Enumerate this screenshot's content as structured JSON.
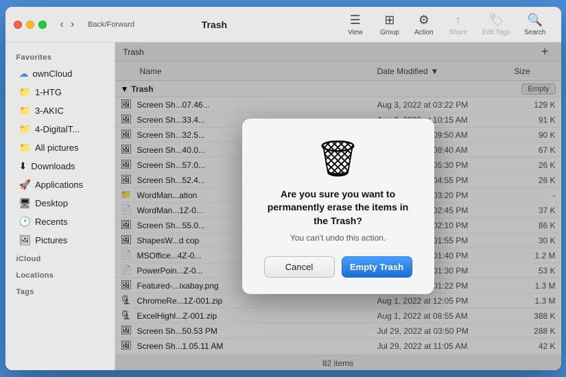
{
  "window": {
    "title": "Trash"
  },
  "traffic_lights": {
    "close": "close",
    "minimize": "minimize",
    "maximize": "maximize"
  },
  "toolbar": {
    "back_forward_label": "Back/Forward",
    "view_label": "View",
    "group_label": "Group",
    "action_label": "Action",
    "share_label": "Share",
    "edit_tags_label": "Edit Tags",
    "search_label": "Search"
  },
  "path_bar": {
    "title": "Trash",
    "add_label": "+"
  },
  "column_headers": {
    "name": "Name",
    "date_modified": "Date Modified",
    "size": "Size"
  },
  "trash_bar": {
    "label": "Trash",
    "empty_btn": "Empty"
  },
  "files": [
    {
      "icon": "🖼",
      "name": "Screen Sh...07.46...",
      "date": "Aug 3, 2022 at 03:22 PM",
      "size": "129 K"
    },
    {
      "icon": "🖼",
      "name": "Screen Sh...33.4...",
      "date": "Aug 2, 2022 at 10:15 AM",
      "size": "91 K"
    },
    {
      "icon": "🖼",
      "name": "Screen Sh...32.5...",
      "date": "Aug 2, 2022 at 09:50 AM",
      "size": "90 K"
    },
    {
      "icon": "🖼",
      "name": "Screen Sh...40.0...",
      "date": "Aug 2, 2022 at 08:40 AM",
      "size": "67 K"
    },
    {
      "icon": "🖼",
      "name": "Screen Sh...57.0...",
      "date": "Aug 1, 2022 at 05:30 PM",
      "size": "26 K"
    },
    {
      "icon": "🖼",
      "name": "Screen Sh...52.4...",
      "date": "Aug 1, 2022 at 04:55 PM",
      "size": "26 K"
    },
    {
      "icon": "📁",
      "name": "WordMan...ation",
      "date": "Aug 1, 2022 at 03:20 PM",
      "size": "-"
    },
    {
      "icon": "📄",
      "name": "WordMan...1Z-0...",
      "date": "Aug 1, 2022 at 02:45 PM",
      "size": "37 K"
    },
    {
      "icon": "🖼",
      "name": "Screen Sh...55.0...",
      "date": "Aug 1, 2022 at 02:10 PM",
      "size": "86 K"
    },
    {
      "icon": "🖼",
      "name": "ShapesW...d cop",
      "date": "Aug 1, 2022 at 01:55 PM",
      "size": "30 K"
    },
    {
      "icon": "📄",
      "name": "MSOffice...4Z-0...",
      "date": "Aug 1, 2022 at 01:40 PM",
      "size": "1.2 M"
    },
    {
      "icon": "📄",
      "name": "PowerPoin...Z-0...",
      "date": "Aug 1, 2022 at 01:30 PM",
      "size": "53 K"
    },
    {
      "icon": "🖼",
      "name": "Featured-...ixabay.png",
      "date": "Aug 1, 2022 at 01:22 PM",
      "size": "1.3 M"
    },
    {
      "icon": "🗜",
      "name": "ChromeRe...1Z-001.zip",
      "date": "Aug 1, 2022 at 12:05 PM",
      "size": "1.3 M"
    },
    {
      "icon": "🗜",
      "name": "ExcelHighl...Z-001.zip",
      "date": "Aug 1, 2022 at 08:55 AM",
      "size": "388 K"
    },
    {
      "icon": "🖼",
      "name": "Screen Sh...50.53 PM",
      "date": "Jul 29, 2022 at 03:50 PM",
      "size": "288 K"
    },
    {
      "icon": "🖼",
      "name": "Screen Sh...1.05.11 AM",
      "date": "Jul 29, 2022 at 11:05 AM",
      "size": "42 K"
    }
  ],
  "status_bar": {
    "text": "82 items"
  },
  "sidebar": {
    "favorites_label": "Favorites",
    "icloud_label": "iCloud",
    "locations_label": "Locations",
    "tags_label": "Tags",
    "items": [
      {
        "id": "owncloud",
        "icon": "☁",
        "label": "ownCloud",
        "section": "favorites"
      },
      {
        "id": "1htg",
        "icon": "📁",
        "label": "1-HTG",
        "section": "favorites"
      },
      {
        "id": "3akic",
        "icon": "📁",
        "label": "3-AKIC",
        "section": "favorites"
      },
      {
        "id": "4digital",
        "icon": "📁",
        "label": "4-DigitalT...",
        "section": "favorites"
      },
      {
        "id": "allpictures",
        "icon": "📁",
        "label": "All pictures",
        "section": "favorites"
      },
      {
        "id": "downloads",
        "icon": "⬇",
        "label": "Downloads",
        "section": "favorites"
      },
      {
        "id": "applications",
        "icon": "🚀",
        "label": "Applications",
        "section": "favorites"
      },
      {
        "id": "desktop",
        "icon": "🖥",
        "label": "Desktop",
        "section": "favorites"
      },
      {
        "id": "recents",
        "icon": "🕐",
        "label": "Recents",
        "section": "favorites"
      },
      {
        "id": "pictures",
        "icon": "🖼",
        "label": "Pictures",
        "section": "favorites"
      }
    ]
  },
  "dialog": {
    "title": "Are you sure you want to permanently erase the items in the Trash?",
    "subtitle": "You can't undo this action.",
    "cancel_label": "Cancel",
    "empty_label": "Empty Trash"
  }
}
